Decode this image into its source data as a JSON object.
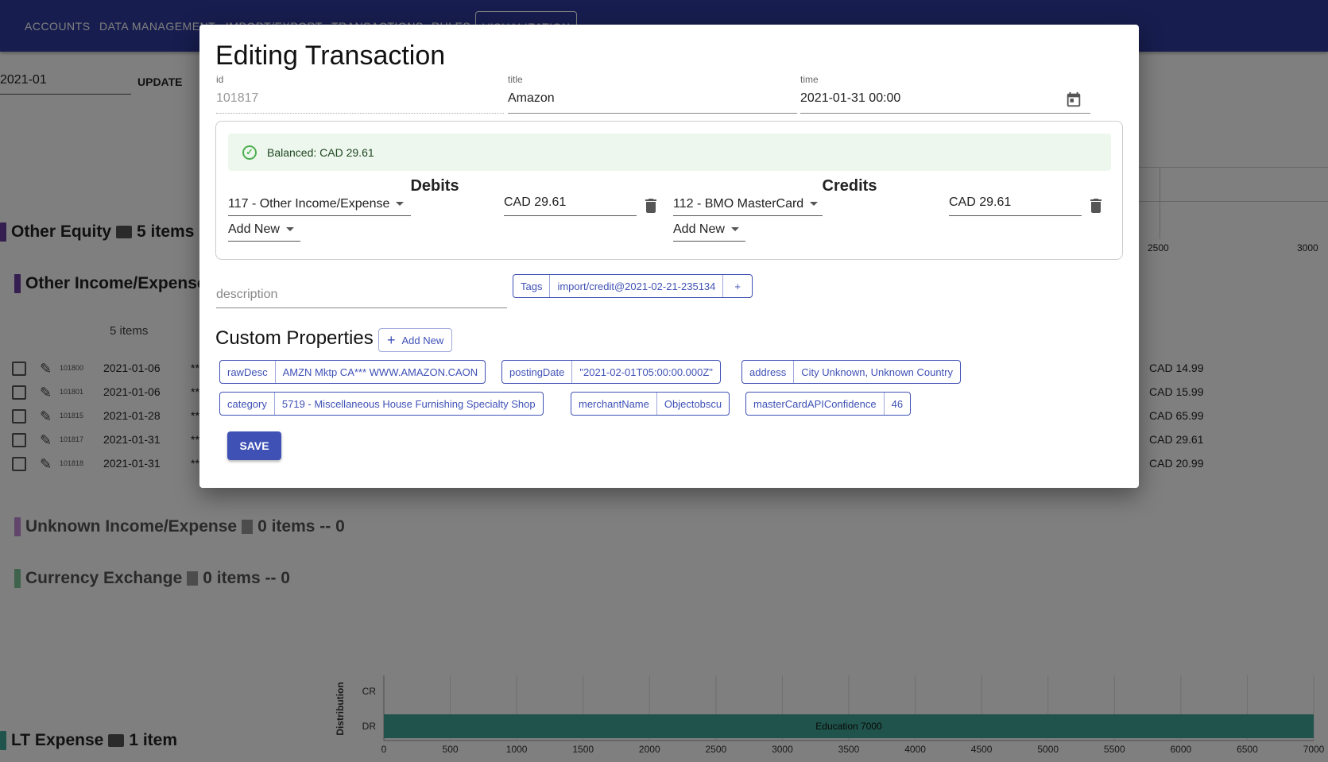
{
  "nav": {
    "items": [
      "ACCOUNTS",
      "DATA MANAGEMENT",
      "IMPORT/EXPORT",
      "TRANSACTIONS",
      "RULES",
      "VISUALIZATION"
    ]
  },
  "filter": {
    "month": "2021-01",
    "update": "UPDATE"
  },
  "sections": {
    "other_equity": {
      "title": "Other Equity",
      "count": "5 items"
    },
    "other_income": {
      "title": "Other Income/Expense",
      "count": "5 items"
    },
    "unknown": {
      "title": "Unknown Income/Expense",
      "count": "0 items -- 0"
    },
    "currency": {
      "title": "Currency Exchange",
      "count": "0 items -- 0"
    },
    "lt_expense": {
      "title": "LT Expense",
      "count": "1 item"
    }
  },
  "rows": [
    {
      "id": "101800",
      "date": "2021-01-06",
      "ast": "**",
      "amount": "CAD 14.99"
    },
    {
      "id": "101801",
      "date": "2021-01-06",
      "ast": "**",
      "amount": "CAD 15.99"
    },
    {
      "id": "101815",
      "date": "2021-01-28",
      "ast": "**",
      "amount": "CAD 65.99"
    },
    {
      "id": "101817",
      "date": "2021-01-31",
      "ast": "**",
      "amount": "CAD 29.61"
    },
    {
      "id": "101818",
      "date": "2021-01-31",
      "ast": "**",
      "amount": "CAD 20.99"
    }
  ],
  "bg_chart": {
    "ticks": [
      "2500",
      "3000"
    ]
  },
  "chart_data": {
    "type": "bar",
    "orientation": "horizontal",
    "ylabel": "Distribution",
    "categories": [
      "CR",
      "DR"
    ],
    "series": [
      {
        "name": "Education",
        "values": [
          0,
          7000
        ]
      }
    ],
    "bar_label": "Education 7000",
    "xlim": [
      0,
      7000
    ],
    "xticks": [
      "0",
      "500",
      "1000",
      "1500",
      "2000",
      "2500",
      "3000",
      "3500",
      "4000",
      "4500",
      "5000",
      "5500",
      "6000",
      "6500",
      "7000"
    ]
  },
  "modal": {
    "title": "Editing Transaction",
    "id_label": "id",
    "id_value": "101817",
    "title_label": "title",
    "title_value": "Amazon",
    "time_label": "time",
    "time_value": "2021-01-31 00:00",
    "balanced": "Balanced: CAD 29.61",
    "debits": "Debits",
    "credits": "Credits",
    "debit_account": "117 - Other Income/Expense",
    "debit_amount": "CAD 29.61",
    "credit_account": "112 - BMO MasterCard",
    "credit_amount": "CAD 29.61",
    "add_new": "Add New",
    "description_placeholder": "description",
    "tags_label": "Tags",
    "tag": "import/credit@2021-02-21-235134",
    "tag_add": "+",
    "custom_props": "Custom Properties",
    "custom_add": "Add New",
    "props": [
      {
        "k": "rawDesc",
        "v": "AMZN Mktp CA*** WWW.AMAZON.CAON"
      },
      {
        "k": "postingDate",
        "v": "\"2021-02-01T05:00:00.000Z\""
      },
      {
        "k": "address",
        "v": "City Unknown, Unknown Country"
      },
      {
        "k": "category",
        "v": "5719 - Miscellaneous House Furnishing Specialty Shop"
      },
      {
        "k": "merchantName",
        "v": "Objectobscu"
      },
      {
        "k": "masterCardAPIConfidence",
        "v": "46"
      }
    ],
    "save": "SAVE"
  },
  "colors": {
    "primary": "#3f51b5",
    "appbar": "#2f3b9c",
    "success": "#4caf50",
    "bar": "#3fa796"
  }
}
